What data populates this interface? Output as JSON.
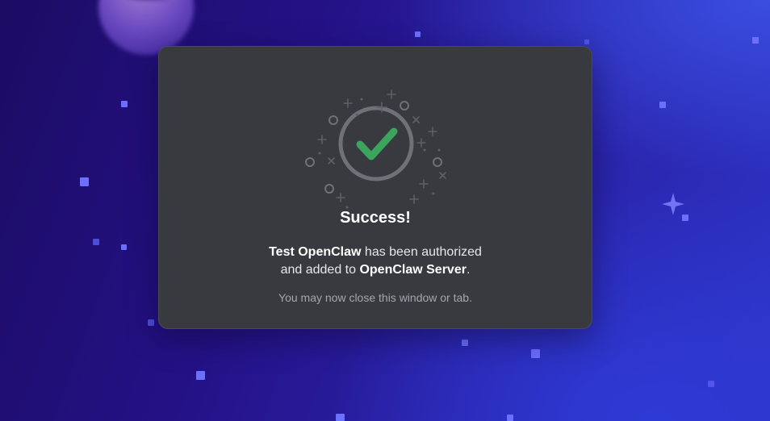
{
  "background": {
    "gradient_colors": [
      "#1c0c63",
      "#241186",
      "#2a22a8",
      "#2d34c6"
    ],
    "star_color": "#6b70ff"
  },
  "modal": {
    "background_color": "#393a40",
    "icon": "success-checkmark-icon",
    "check_color": "#3ba55d",
    "ring_color": "#6f7178",
    "title": "Success!",
    "message": {
      "app_name": "Test OpenClaw",
      "line1_suffix": " has been authorized",
      "line2_prefix": "and added to ",
      "server_name": "OpenClaw Server",
      "line2_suffix": "."
    },
    "note": "You may now close this window or tab."
  }
}
